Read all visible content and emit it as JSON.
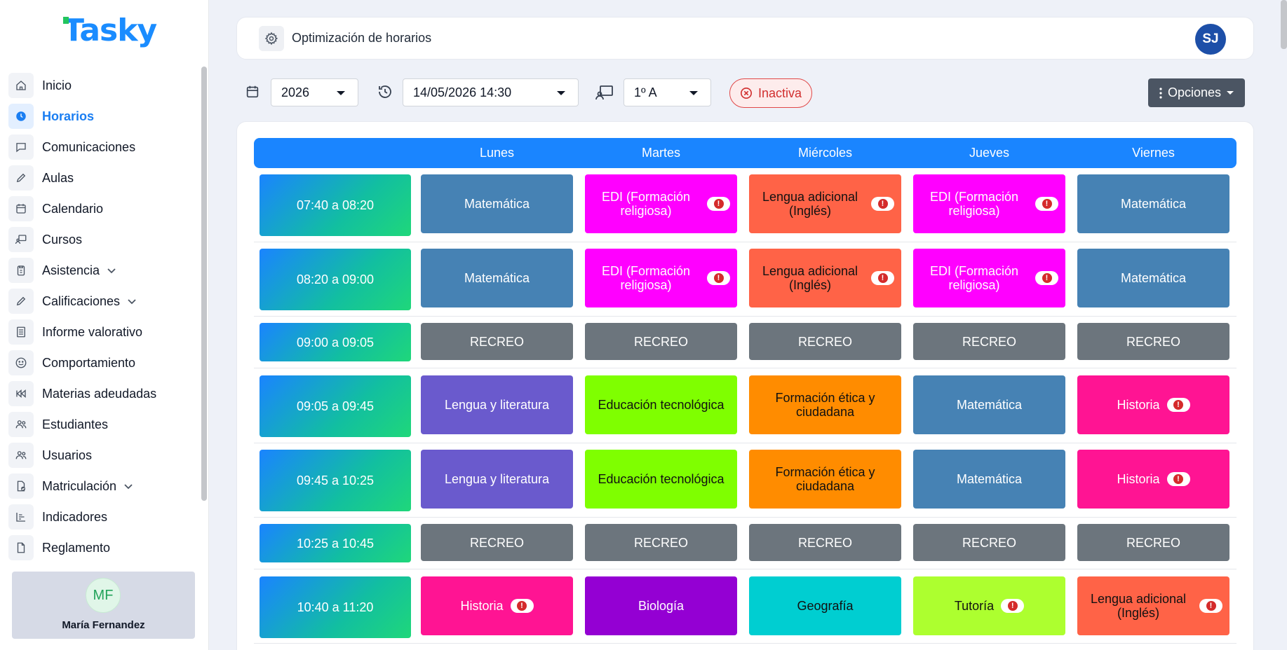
{
  "app": {
    "logo": "Tasky",
    "page_title": "Optimización de horarios",
    "user_initials": "SJ"
  },
  "sidebar": {
    "items": [
      {
        "label": "Inicio",
        "icon": "home-icon"
      },
      {
        "label": "Horarios",
        "icon": "clock-icon",
        "active": true
      },
      {
        "label": "Comunicaciones",
        "icon": "chat-icon"
      },
      {
        "label": "Aulas",
        "icon": "pencil-icon"
      },
      {
        "label": "Calendario",
        "icon": "calendar-icon"
      },
      {
        "label": "Cursos",
        "icon": "presentation-icon"
      },
      {
        "label": "Asistencia",
        "icon": "clipboard-icon",
        "expandable": true
      },
      {
        "label": "Calificaciones",
        "icon": "pencil-icon",
        "expandable": true
      },
      {
        "label": "Informe valorativo",
        "icon": "document-icon"
      },
      {
        "label": "Comportamiento",
        "icon": "smile-icon"
      },
      {
        "label": "Materias adeudadas",
        "icon": "rewind-icon"
      },
      {
        "label": "Estudiantes",
        "icon": "people-icon"
      },
      {
        "label": "Usuarios",
        "icon": "people-icon"
      },
      {
        "label": "Matriculación",
        "icon": "file-check-icon",
        "expandable": true
      },
      {
        "label": "Indicadores",
        "icon": "bar-chart-icon"
      },
      {
        "label": "Reglamento",
        "icon": "file-icon"
      }
    ],
    "user": {
      "initials": "MF",
      "name": "María Fernandez"
    }
  },
  "toolbar": {
    "year": "2026",
    "datetime": "14/05/2026 14:30",
    "course": "1º A",
    "status": "Inactiva",
    "options_label": "Opciones"
  },
  "schedule": {
    "days": [
      "Lunes",
      "Martes",
      "Miércoles",
      "Jueves",
      "Viernes"
    ],
    "rows": [
      {
        "time": "07:40 a 08:20",
        "cells": [
          {
            "subject": "Matemática",
            "color": "#4682b4",
            "text": "#ffffff"
          },
          {
            "subject": "EDI (Formación religiosa)",
            "color": "#ff00ff",
            "text": "#ffffff",
            "warning": true
          },
          {
            "subject": "Lengua adicional (Inglés)",
            "color": "#ff6347",
            "text": "#111111",
            "warning": true
          },
          {
            "subject": "EDI (Formación religiosa)",
            "color": "#ff00ff",
            "text": "#ffffff",
            "warning": true
          },
          {
            "subject": "Matemática",
            "color": "#4682b4",
            "text": "#ffffff"
          }
        ]
      },
      {
        "time": "08:20 a 09:00",
        "cells": [
          {
            "subject": "Matemática",
            "color": "#4682b4",
            "text": "#ffffff"
          },
          {
            "subject": "EDI (Formación religiosa)",
            "color": "#ff00ff",
            "text": "#ffffff",
            "warning": true
          },
          {
            "subject": "Lengua adicional (Inglés)",
            "color": "#ff6347",
            "text": "#111111",
            "warning": true
          },
          {
            "subject": "EDI (Formación religiosa)",
            "color": "#ff00ff",
            "text": "#ffffff",
            "warning": true
          },
          {
            "subject": "Matemática",
            "color": "#4682b4",
            "text": "#ffffff"
          }
        ]
      },
      {
        "time": "09:00 a 09:05",
        "cells": [
          {
            "subject": "RECREO",
            "color": "#6c757d",
            "text": "#ffffff"
          },
          {
            "subject": "RECREO",
            "color": "#6c757d",
            "text": "#ffffff"
          },
          {
            "subject": "RECREO",
            "color": "#6c757d",
            "text": "#ffffff"
          },
          {
            "subject": "RECREO",
            "color": "#6c757d",
            "text": "#ffffff"
          },
          {
            "subject": "RECREO",
            "color": "#6c757d",
            "text": "#ffffff"
          }
        ]
      },
      {
        "time": "09:05 a 09:45",
        "cells": [
          {
            "subject": "Lengua y literatura",
            "color": "#6a5acd",
            "text": "#ffffff"
          },
          {
            "subject": "Educación tecnológica",
            "color": "#7fff00",
            "text": "#111111"
          },
          {
            "subject": "Formación ética y ciudadana",
            "color": "#ff8c00",
            "text": "#111111"
          },
          {
            "subject": "Matemática",
            "color": "#4682b4",
            "text": "#ffffff"
          },
          {
            "subject": "Historia",
            "color": "#ff1493",
            "text": "#ffffff",
            "warning": true
          }
        ]
      },
      {
        "time": "09:45 a 10:25",
        "cells": [
          {
            "subject": "Lengua y literatura",
            "color": "#6a5acd",
            "text": "#ffffff"
          },
          {
            "subject": "Educación tecnológica",
            "color": "#7fff00",
            "text": "#111111"
          },
          {
            "subject": "Formación ética y ciudadana",
            "color": "#ff8c00",
            "text": "#111111"
          },
          {
            "subject": "Matemática",
            "color": "#4682b4",
            "text": "#ffffff"
          },
          {
            "subject": "Historia",
            "color": "#ff1493",
            "text": "#ffffff",
            "warning": true
          }
        ]
      },
      {
        "time": "10:25 a 10:45",
        "cells": [
          {
            "subject": "RECREO",
            "color": "#6c757d",
            "text": "#ffffff"
          },
          {
            "subject": "RECREO",
            "color": "#6c757d",
            "text": "#ffffff"
          },
          {
            "subject": "RECREO",
            "color": "#6c757d",
            "text": "#ffffff"
          },
          {
            "subject": "RECREO",
            "color": "#6c757d",
            "text": "#ffffff"
          },
          {
            "subject": "RECREO",
            "color": "#6c757d",
            "text": "#ffffff"
          }
        ]
      },
      {
        "time": "10:40 a 11:20",
        "cells": [
          {
            "subject": "Historia",
            "color": "#ff1493",
            "text": "#ffffff",
            "warning": true
          },
          {
            "subject": "Biología",
            "color": "#9400d3",
            "text": "#ffffff"
          },
          {
            "subject": "Geografía",
            "color": "#00ced1",
            "text": "#111111"
          },
          {
            "subject": "Tutoría",
            "color": "#adff2f",
            "text": "#111111",
            "warning": true
          },
          {
            "subject": "Lengua adicional (Inglés)",
            "color": "#ff6347",
            "text": "#111111",
            "warning": true
          }
        ]
      }
    ]
  }
}
